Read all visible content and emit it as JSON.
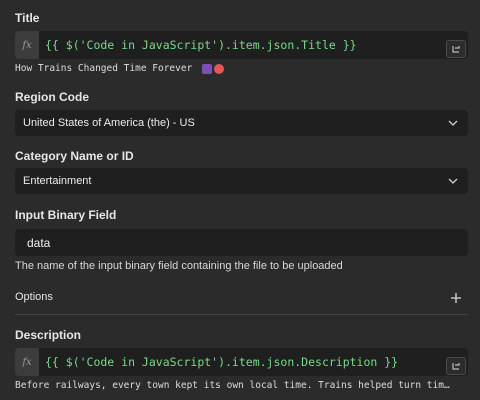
{
  "title_field": {
    "label": "Title",
    "fx": "fx",
    "expression": "{{ $('Code in JavaScript').item.json.Title }}",
    "preview": "How Trains Changed Time Forever",
    "preview_emojis": [
      "train-emoji",
      "alarm-clock-emoji"
    ]
  },
  "region_field": {
    "label": "Region Code",
    "value": "United States of America (the) - US"
  },
  "category_field": {
    "label": "Category Name or ID",
    "value": "Entertainment"
  },
  "binary_field": {
    "label": "Input Binary Field",
    "value": "data",
    "hint": "The name of the input binary field containing the file to be uploaded"
  },
  "options": {
    "label": "Options"
  },
  "description_field": {
    "label": "Description",
    "fx": "fx",
    "expression": "{{ $('Code in JavaScript').item.json.Description }}",
    "preview": "Before railways, every town kept its own local time. Trains helped turn tim…"
  },
  "colors": {
    "background": "#2b2b2b",
    "field": "#1f1f1f",
    "expression_text": "#7ad88a"
  }
}
